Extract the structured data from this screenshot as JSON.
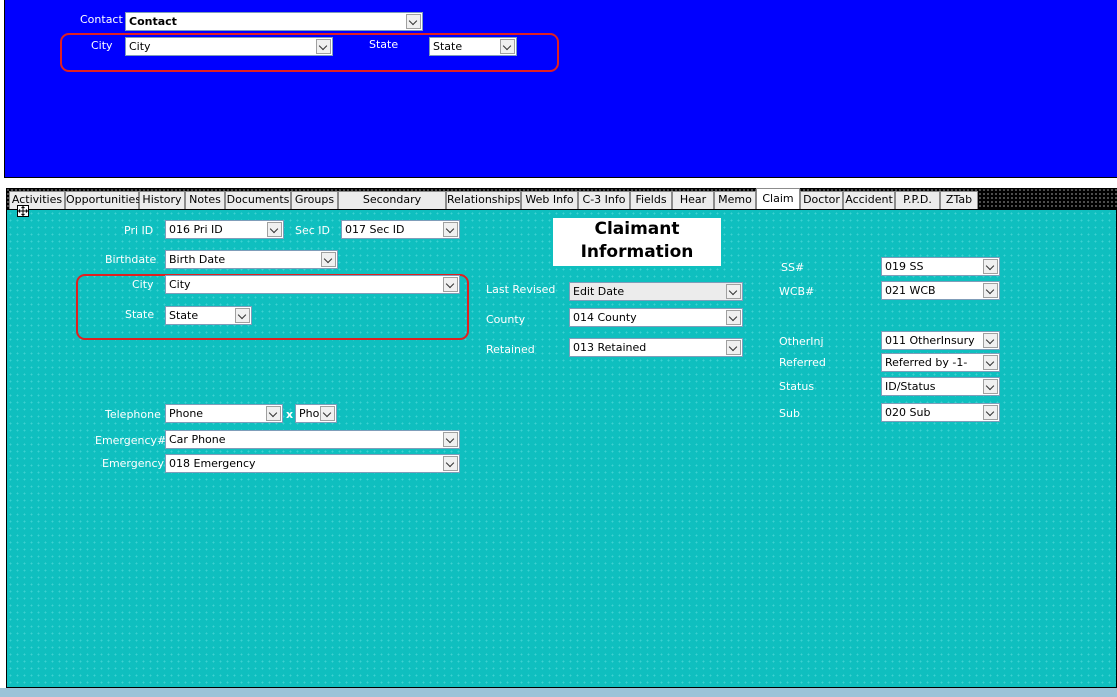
{
  "header": {
    "contact_label": "Contact",
    "contact_value": "Contact",
    "city_label": "City",
    "city_value": "City",
    "state_label": "State",
    "state_value": "State"
  },
  "tabs": [
    {
      "label": "Activities"
    },
    {
      "label": "Opportunities"
    },
    {
      "label": "History"
    },
    {
      "label": "Notes"
    },
    {
      "label": "Documents"
    },
    {
      "label": "Groups"
    },
    {
      "label": "Secondary Contacts"
    },
    {
      "label": "Relationships"
    },
    {
      "label": "Web Info"
    },
    {
      "label": "C-3 Info"
    },
    {
      "label": "Fields"
    },
    {
      "label": "Hear"
    },
    {
      "label": "Memo"
    },
    {
      "label": "Claim"
    },
    {
      "label": "Doctor"
    },
    {
      "label": "Accident"
    },
    {
      "label": "P.P.D."
    },
    {
      "label": "ZTab"
    }
  ],
  "active_tab": "Claim",
  "title": "Claimant Information",
  "title_line1": "Claimant",
  "title_line2": "Information",
  "left": {
    "pri_id_label": "Pri ID",
    "pri_id_value": "016 Pri ID",
    "sec_id_label": "Sec ID",
    "sec_id_value": "017 Sec ID",
    "birthdate_label": "Birthdate",
    "birthdate_value": "Birth Date",
    "city_label": "City",
    "city_value": "City",
    "state_label": "State",
    "state_value": "State",
    "telephone_label": "Telephone",
    "telephone_value": "Phone",
    "ext_label": "x",
    "ext_value": "Phone",
    "emergency_num_label": "Emergency#",
    "emergency_num_value": "Car Phone",
    "emergency_label": "Emergency",
    "emergency_value": "018 Emergency"
  },
  "middle": {
    "last_revised_label": "Last Revised",
    "last_revised_value": "Edit Date",
    "county_label": "County",
    "county_value": "014 County",
    "retained_label": "Retained",
    "retained_value": "013 Retained"
  },
  "right": {
    "ss_label": "SS#",
    "ss_value": "019 SS",
    "wcb_label": "WCB#",
    "wcb_value": "021 WCB",
    "otherinj_label": "OtherInj",
    "otherinj_value": "011 OtherInsury",
    "referred_label": "Referred",
    "referred_value": "Referred by -1-",
    "status_label": "Status",
    "status_value": "ID/Status",
    "sub_label": "Sub",
    "sub_value": "020 Sub"
  },
  "colors": {
    "header_bg": "#0000ff",
    "form_bg": "#0fbfbf",
    "highlight": "#e02020"
  }
}
